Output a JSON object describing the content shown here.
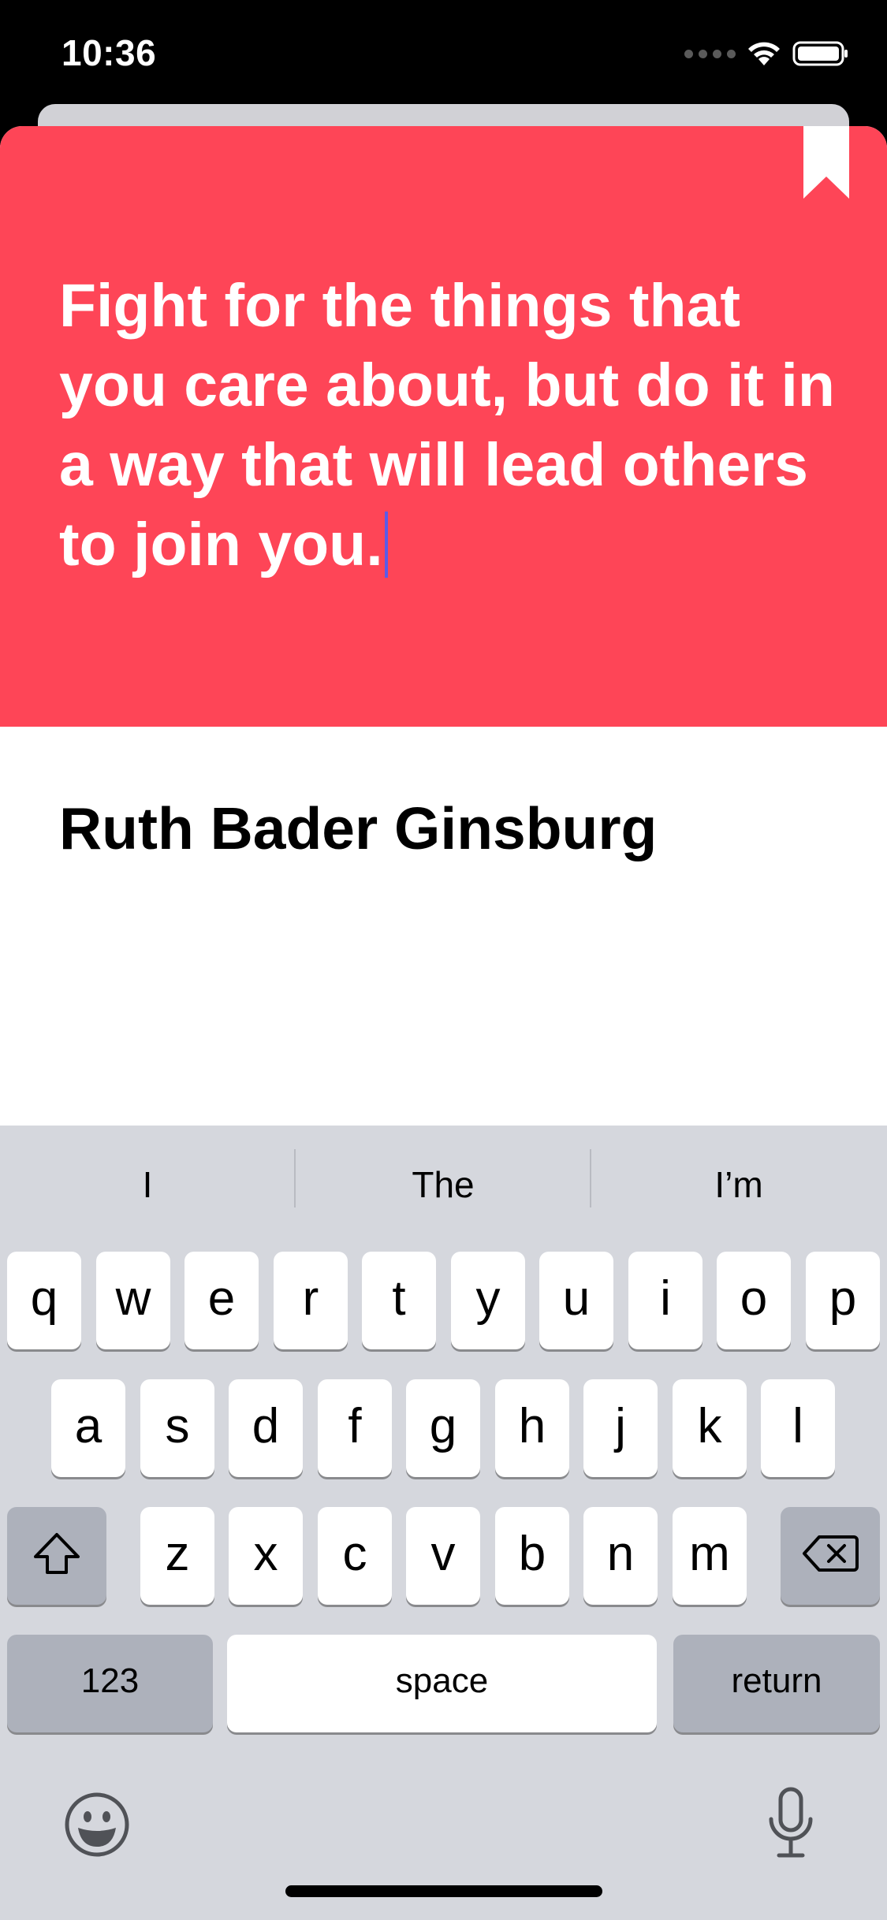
{
  "status_bar": {
    "time": "10:36",
    "icons": [
      "signal-dots-icon",
      "wifi-icon",
      "battery-icon"
    ]
  },
  "quote_card": {
    "accent_color": "#fe4557",
    "quote": "Fight for the things that you care about, but do it in a way that will lead others to join you.",
    "bookmark_icon": "bookmark-icon",
    "author": "Ruth Bader Ginsburg"
  },
  "keyboard": {
    "suggestions": [
      "I",
      "The",
      "I’m"
    ],
    "row1": [
      "q",
      "w",
      "e",
      "r",
      "t",
      "y",
      "u",
      "i",
      "o",
      "p"
    ],
    "row2": [
      "a",
      "s",
      "d",
      "f",
      "g",
      "h",
      "j",
      "k",
      "l"
    ],
    "row3": [
      "z",
      "x",
      "c",
      "v",
      "b",
      "n",
      "m"
    ],
    "shift_icon": "shift-icon",
    "delete_icon": "delete-icon",
    "numbers_label": "123",
    "space_label": "space",
    "return_label": "return",
    "emoji_icon": "emoji-icon",
    "mic_icon": "microphone-icon"
  }
}
